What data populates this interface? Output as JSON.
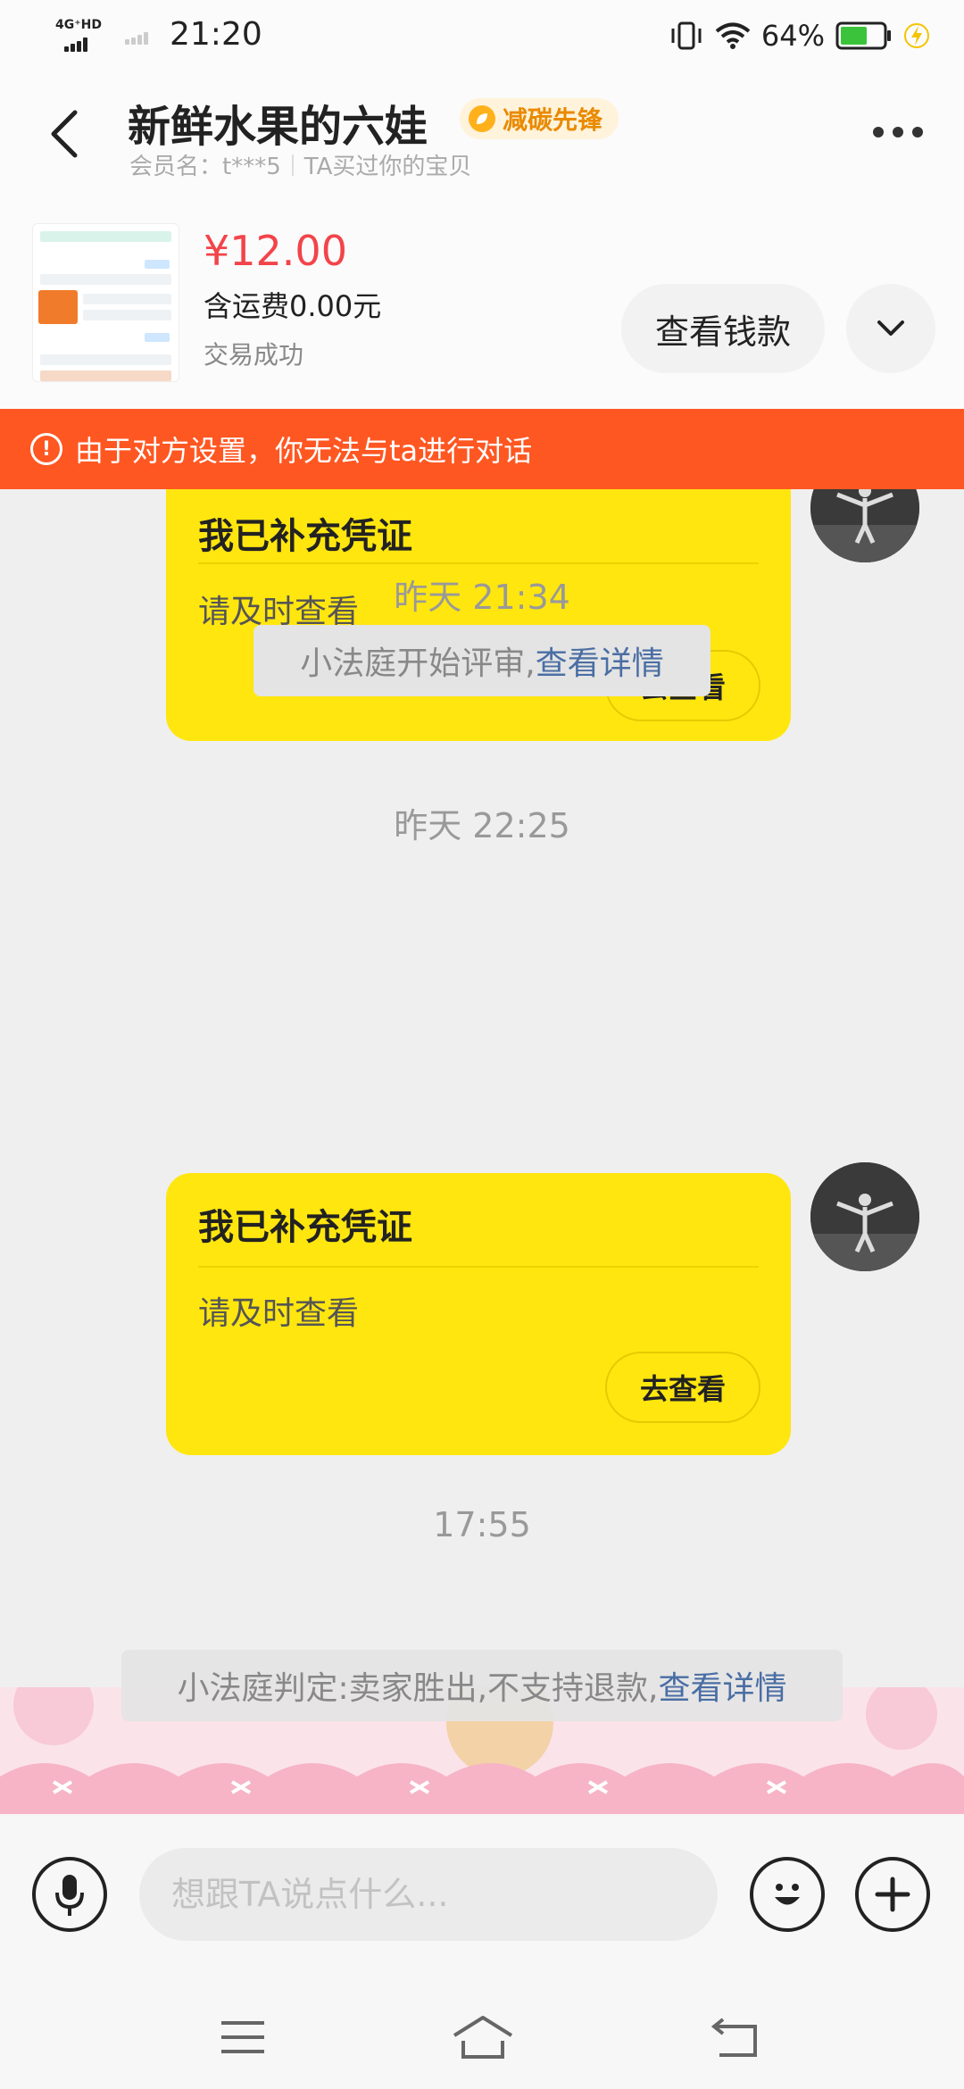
{
  "status_bar": {
    "network": "4G⁺HD",
    "time": "21:20",
    "battery_percent": "64%",
    "battery_level": 0.64
  },
  "header": {
    "title": "新鲜水果的六娃",
    "badge": "减碳先锋",
    "member_label": "会员名：t***5",
    "relation_label": "TA买过你的宝贝"
  },
  "order": {
    "price": "¥12.00",
    "shipping": "含运费0.00元",
    "status": "交易成功",
    "check_payment_button": "查看钱款"
  },
  "alert": {
    "icon": "exclamation-circle-icon",
    "text": "由于对方设置，你无法与ta进行对话"
  },
  "messages": [
    {
      "type": "card",
      "title": "我已补充凭证",
      "subtitle": "请及时查看",
      "button": "去查看"
    },
    {
      "type": "timestamp",
      "text": "昨天 21:34"
    },
    {
      "type": "system",
      "text": "小法庭开始评审,",
      "link": "查看详情"
    },
    {
      "type": "timestamp",
      "text": "昨天 22:25"
    },
    {
      "type": "card",
      "title": "我已补充凭证",
      "subtitle": "请及时查看",
      "button": "去查看"
    },
    {
      "type": "timestamp",
      "text": "17:55"
    },
    {
      "type": "system",
      "text": "小法庭判定:卖家胜出,不支持退款,",
      "link": "查看详情"
    }
  ],
  "input_bar": {
    "placeholder": "想跟TA说点什么...",
    "voice_icon": "microphone-icon",
    "emoji_icon": "emoji-icon",
    "plus_icon": "plus-icon"
  },
  "colors": {
    "accent_yellow": "#ffe60f",
    "alert_orange": "#ff5722",
    "price_red": "#f2444a",
    "link_blue": "#4a6ea4"
  }
}
